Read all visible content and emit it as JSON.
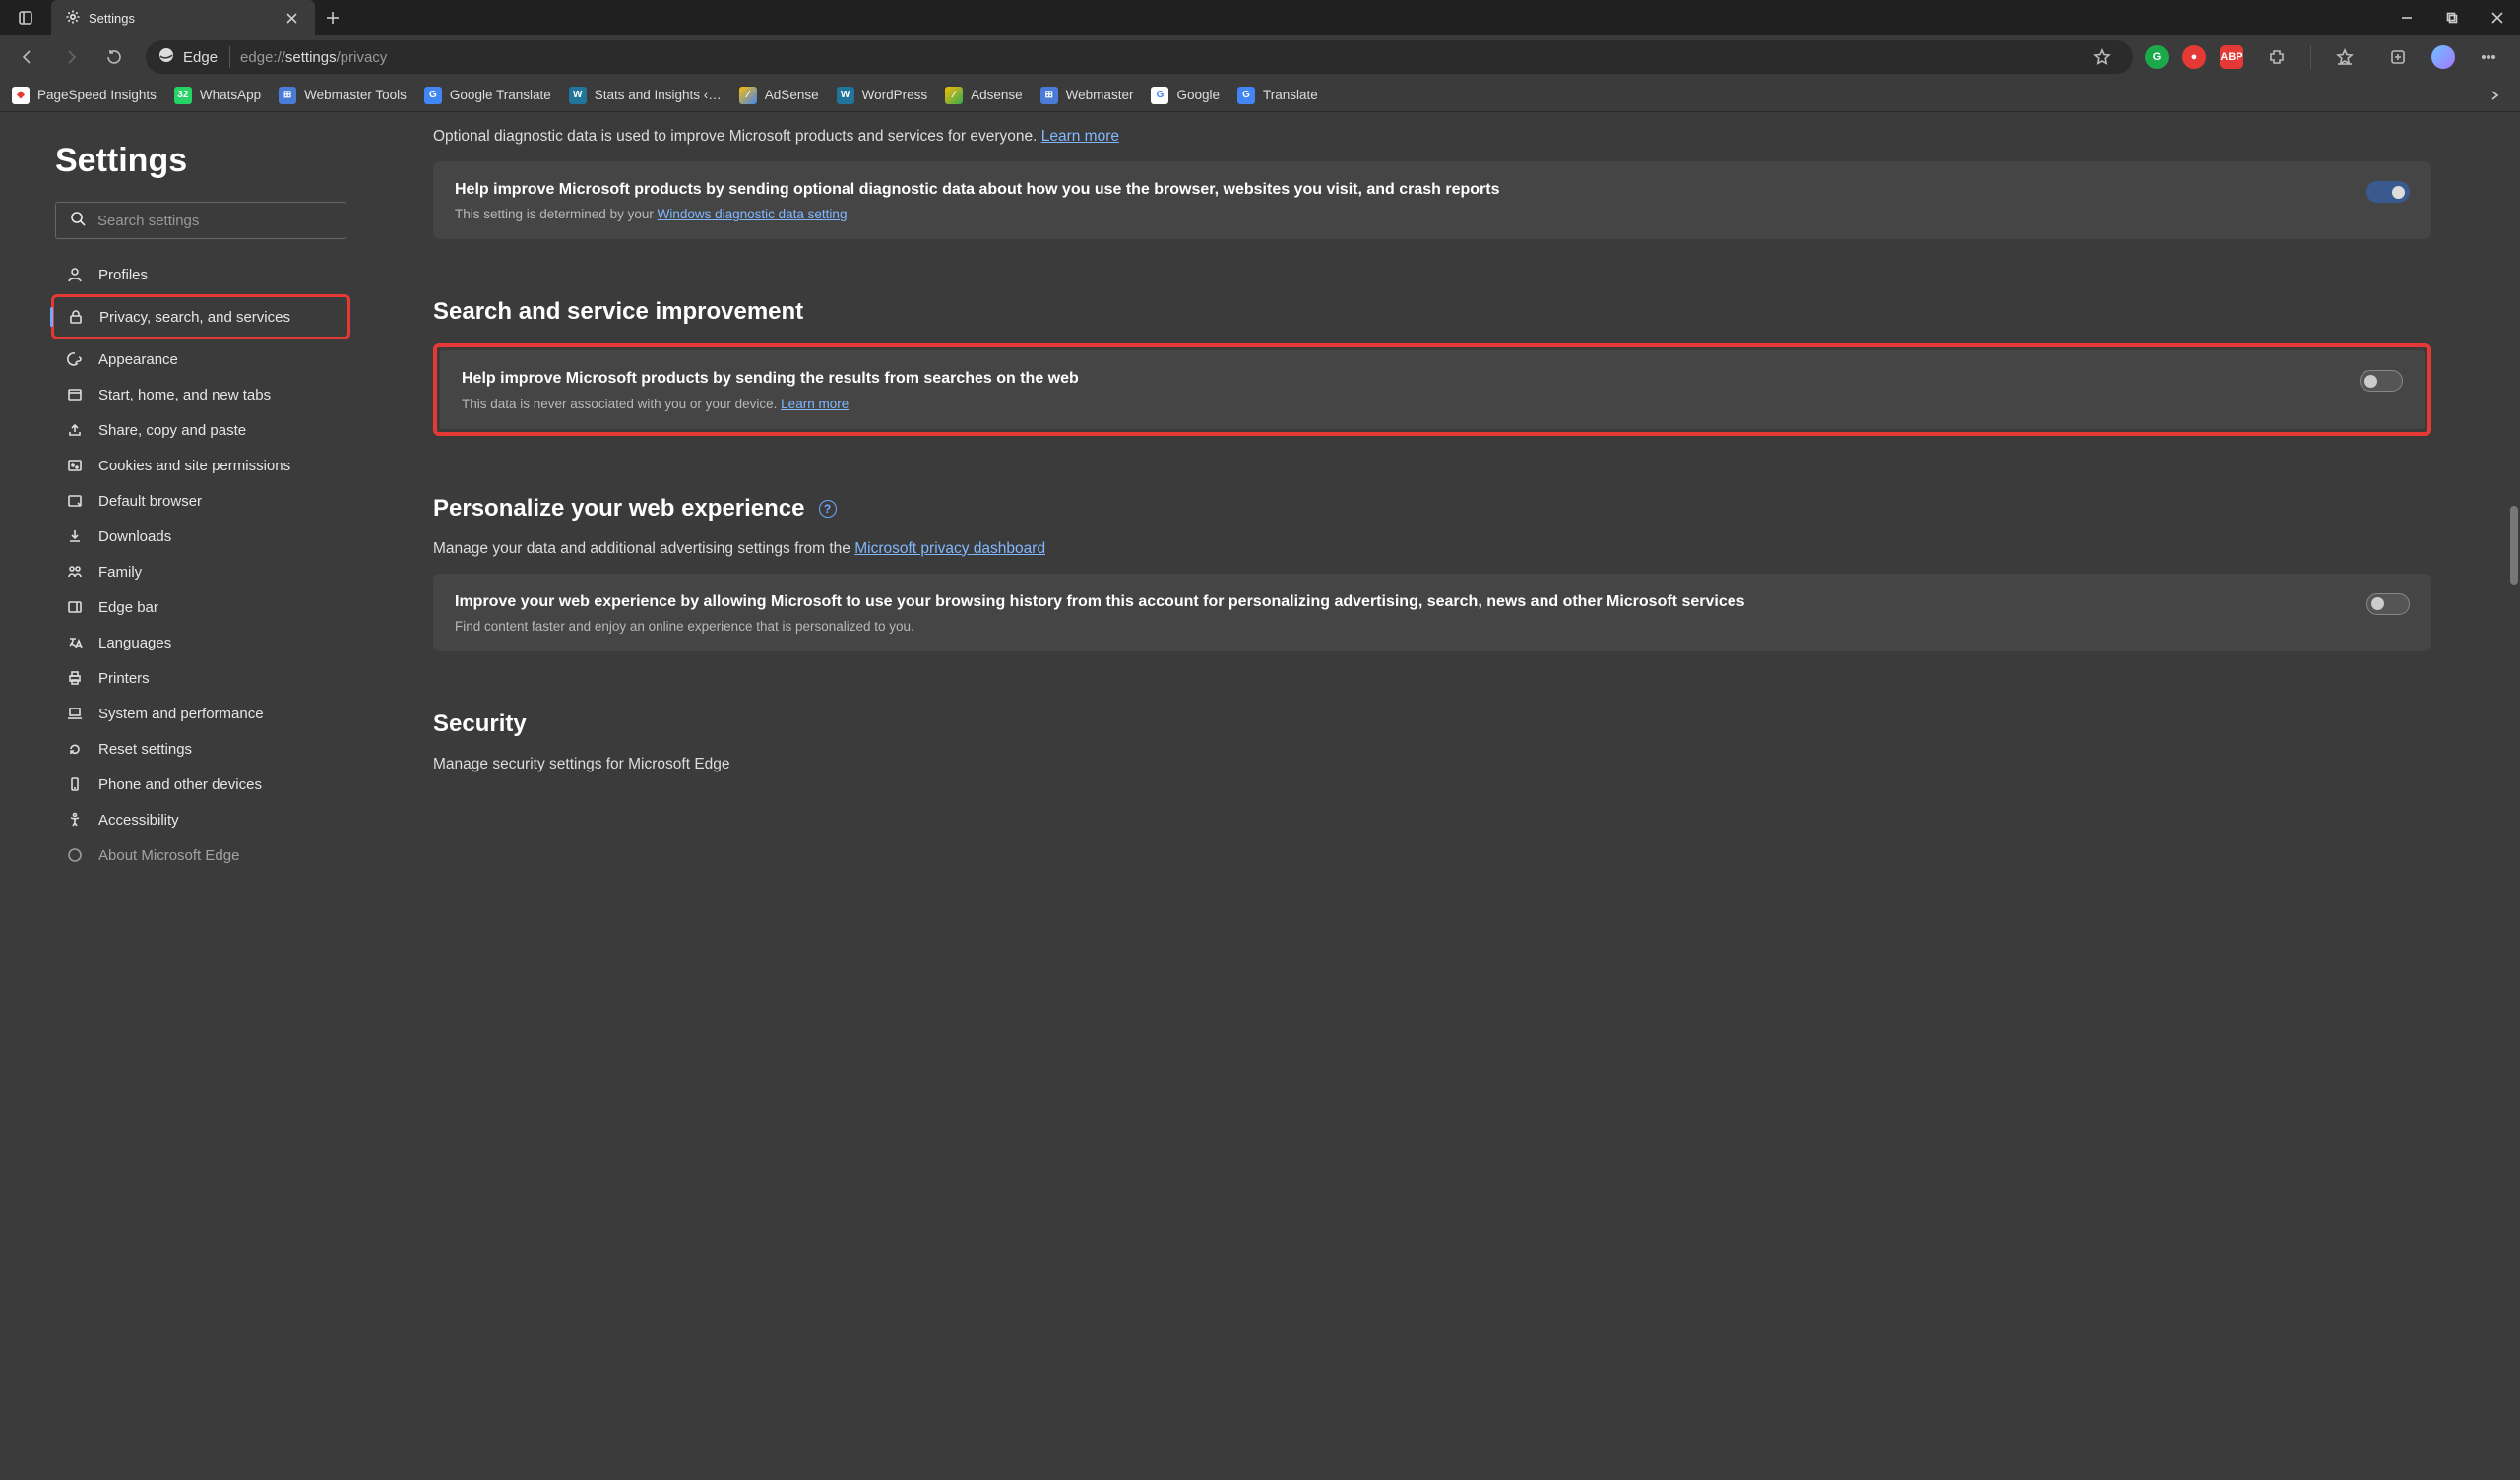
{
  "window": {
    "tab_title": "Settings"
  },
  "toolbar": {
    "edge_label": "Edge",
    "url_prefix": "edge://",
    "url_mid": "settings",
    "url_suffix": "/privacy"
  },
  "bookmarks": [
    {
      "label": "PageSpeed Insights",
      "color": "#fff"
    },
    {
      "label": "WhatsApp",
      "color": "#25d366"
    },
    {
      "label": "Webmaster Tools",
      "color": "#5b8def"
    },
    {
      "label": "Google Translate",
      "color": "#4285f4"
    },
    {
      "label": "Stats and Insights ‹…",
      "color": "#21759b"
    },
    {
      "label": "AdSense",
      "color": "#fbbc04"
    },
    {
      "label": "WordPress",
      "color": "#21759b"
    },
    {
      "label": "Adsense",
      "color": "#fbbc04"
    },
    {
      "label": "Webmaster",
      "color": "#5b8def"
    },
    {
      "label": "Google",
      "color": "#fff"
    },
    {
      "label": "Translate",
      "color": "#4285f4"
    }
  ],
  "sidebar": {
    "title": "Settings",
    "search_placeholder": "Search settings",
    "items": [
      {
        "label": "Profiles"
      },
      {
        "label": "Privacy, search, and services"
      },
      {
        "label": "Appearance"
      },
      {
        "label": "Start, home, and new tabs"
      },
      {
        "label": "Share, copy and paste"
      },
      {
        "label": "Cookies and site permissions"
      },
      {
        "label": "Default browser"
      },
      {
        "label": "Downloads"
      },
      {
        "label": "Family"
      },
      {
        "label": "Edge bar"
      },
      {
        "label": "Languages"
      },
      {
        "label": "Printers"
      },
      {
        "label": "System and performance"
      },
      {
        "label": "Reset settings"
      },
      {
        "label": "Phone and other devices"
      },
      {
        "label": "Accessibility"
      },
      {
        "label": "About Microsoft Edge"
      }
    ]
  },
  "main": {
    "diag_intro": "Optional diagnostic data is used to improve Microsoft products and services for everyone. ",
    "diag_learn": "Learn more",
    "diag_card_title": "Help improve Microsoft products by sending optional diagnostic data about how you use the browser, websites you visit, and crash reports",
    "diag_card_sub_prefix": "This setting is determined by your ",
    "diag_card_sub_link": "Windows diagnostic data setting",
    "search_section_title": "Search and service improvement",
    "search_card_title": "Help improve Microsoft products by sending the results from searches on the web",
    "search_card_sub_prefix": "This data is never associated with you or your device. ",
    "search_card_sub_link": "Learn more",
    "personalize_title": "Personalize your web experience",
    "personalize_desc_prefix": "Manage your data and additional advertising settings from the ",
    "personalize_desc_link": "Microsoft privacy dashboard",
    "personalize_card_title": "Improve your web experience by allowing Microsoft to use your browsing history from this account for personalizing advertising, search, news and other Microsoft services",
    "personalize_card_sub": "Find content faster and enjoy an online experience that is personalized to you.",
    "security_title": "Security",
    "security_desc": "Manage security settings for Microsoft Edge"
  }
}
